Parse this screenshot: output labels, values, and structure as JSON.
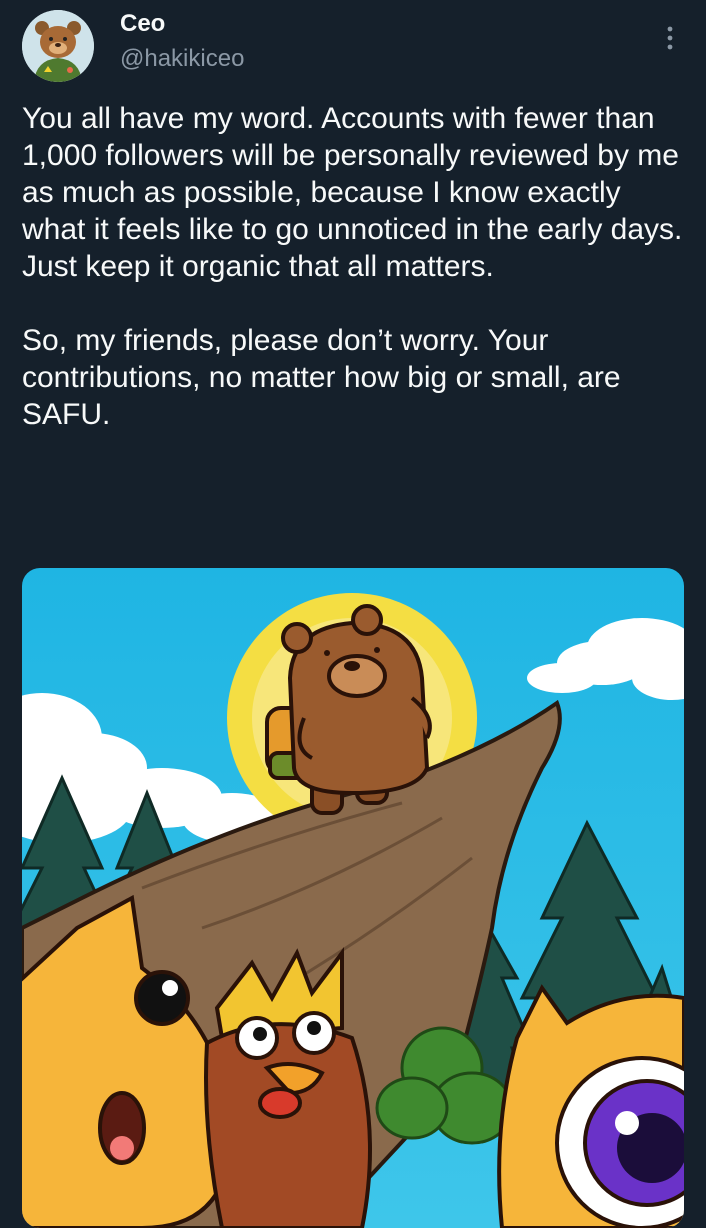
{
  "tweet": {
    "author": {
      "display_name": "Ceo",
      "handle": "@hakikiceo",
      "avatar_icon": "bear-avatar-icon"
    },
    "paragraphs": [
      "You all have my word. Accounts with fewer than 1,000 followers will be personally reviewed by me as much as possible, because I know exactly what it feels like to go unnoticed in the early days. Just keep it organic that all matters.",
      "So, my friends, please don’t worry. Your contributions, no matter how big or small, are SAFU."
    ],
    "more_icon": "more-vertical-icon",
    "media": {
      "kind": "illustration",
      "subject_icons": [
        "bear-hiker-icon",
        "sun-icon",
        "cliff-icon",
        "pine-tree-icon",
        "cloud-icon",
        "cat-character-icon",
        "crowned-rooster-icon",
        "yellow-creature-icon"
      ]
    }
  },
  "colors": {
    "background": "#15202b",
    "text_primary": "#f7f9f9",
    "text_secondary": "#8b98a5",
    "sky": "#27b9e4",
    "sun": "#f2d22d",
    "bear": "#9a5b2e",
    "cliff": "#8a6a4c",
    "pine": "#1f4f46"
  }
}
